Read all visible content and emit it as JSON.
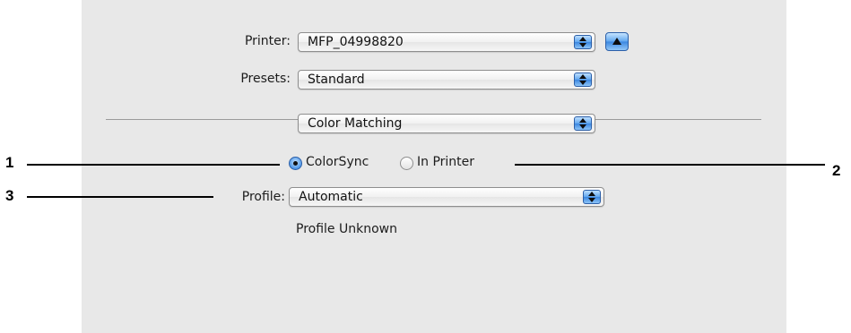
{
  "printer": {
    "label": "Printer:",
    "value": "MFP_04998820"
  },
  "presets": {
    "label": "Presets:",
    "value": "Standard"
  },
  "panel_menu": {
    "value": "Color Matching"
  },
  "color_mode": {
    "colorsync": "ColorSync",
    "in_printer": "In Printer",
    "selected": "colorsync"
  },
  "profile": {
    "label": "Profile:",
    "value": "Automatic",
    "status": "Profile Unknown"
  },
  "callouts": {
    "c1": "1",
    "c2": "2",
    "c3": "3"
  },
  "colors": {
    "accent": "#3a86e0",
    "panel_bg": "#e8e8e8"
  },
  "icons": {
    "disclosure": "disclosure-triangle-up-icon",
    "popup_arrows": "updown-arrows-icon"
  }
}
